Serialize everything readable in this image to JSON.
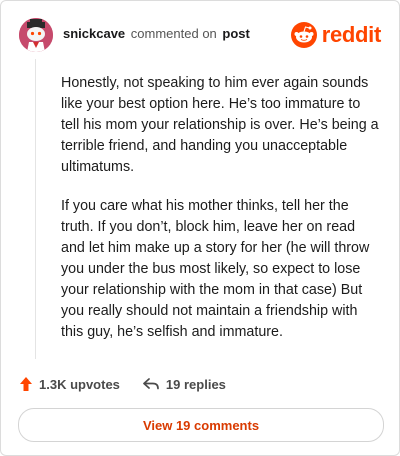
{
  "header": {
    "username": "snickcave",
    "action_text": "commented on",
    "post_link": "post",
    "brand_name": "reddit"
  },
  "comment": {
    "paragraphs": [
      "Honestly, not speaking to him ever again sounds like your best option here. He’s too immature to tell his mom your relationship is over. He’s being a terrible friend, and handing you unacceptable ultimatums.",
      "If you care what his mother thinks, tell her the truth. If you don’t, block him, leave her on read and let him make up a story for her (he will throw you under the bus most likely, so expect to lose your relationship with the mom in that case) But you really should not maintain a friendship with this guy, he’s selfish and immature."
    ]
  },
  "actions": {
    "upvotes": "1.3K upvotes",
    "replies": "19 replies"
  },
  "footer": {
    "view_comments_label": "View 19 comments"
  },
  "colors": {
    "brand": "#ff4500",
    "upvote": "#ff4500",
    "link_orange": "#d93a00"
  },
  "icons": {
    "avatar": "snoo-avatar",
    "brand": "reddit-logo-icon",
    "upvote": "upvote-arrow-icon",
    "reply": "reply-arrow-icon"
  }
}
